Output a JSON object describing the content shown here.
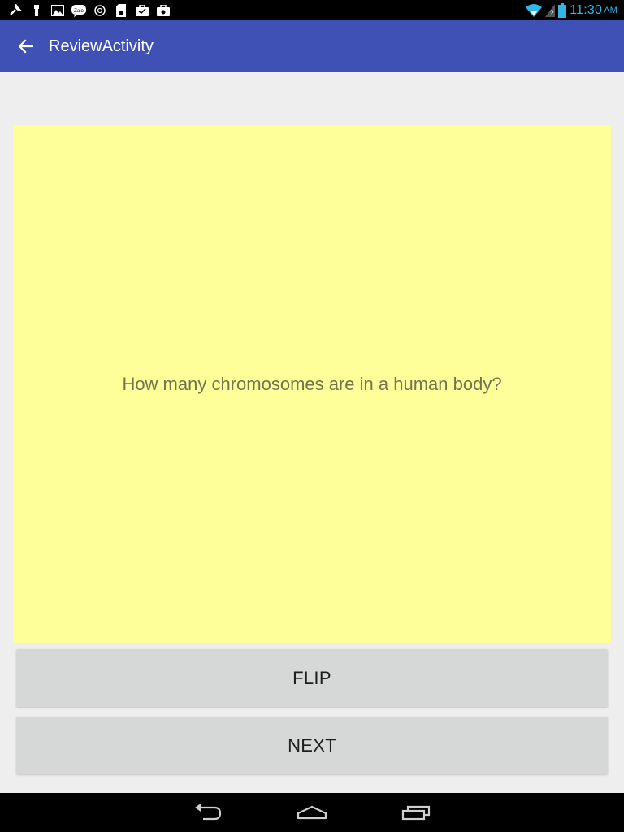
{
  "status_bar": {
    "time": "11:30",
    "ampm": "AM",
    "left_icons": [
      "wrench-icon",
      "usb-icon",
      "image-icon",
      "zalo-icon",
      "sync-icon",
      "sd-card-icon",
      "briefcase-icon",
      "briefcase-notification-icon"
    ],
    "right_icons": [
      "wifi-icon",
      "signal-icon",
      "battery-icon"
    ],
    "clock_color": "#33b5e5"
  },
  "app_bar": {
    "title": "ReviewActivity",
    "back_icon": "arrow-back-icon",
    "color": "#3f51b5"
  },
  "card": {
    "question": "How many chromosomes are in a human body?",
    "background": "#ffff99"
  },
  "buttons": {
    "flip_label": "FLIP",
    "next_label": "NEXT"
  },
  "nav_bar": {
    "icons": [
      "back-nav-icon",
      "home-nav-icon",
      "recents-nav-icon"
    ]
  }
}
